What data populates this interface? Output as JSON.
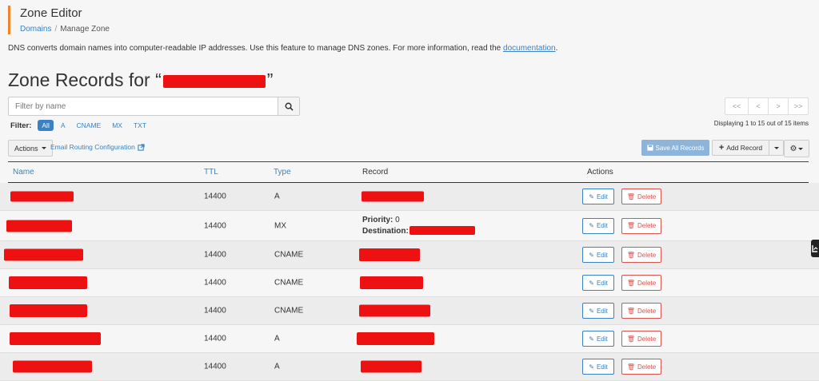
{
  "header": {
    "title": "Zone Editor",
    "breadcrumb": [
      "Domains",
      "Manage Zone"
    ],
    "accent_color": "#f08329"
  },
  "description": {
    "text": "DNS converts domain names into computer-readable IP addresses. Use this feature to manage DNS zones. For more information, read the ",
    "link": "documentation",
    "end": "."
  },
  "heading": {
    "prefix": "Zone Records for “",
    "suffix": "”",
    "domain_redacted": true
  },
  "search": {
    "placeholder": "Filter by name",
    "icon": "search-icon"
  },
  "filter": {
    "label": "Filter:",
    "options": [
      "All",
      "A",
      "CNAME",
      "MX",
      "TXT"
    ],
    "selected": "All"
  },
  "pagination": {
    "buttons": [
      "<<",
      "<",
      ">",
      ">>"
    ],
    "status": "Displaying 1 to 15 out of 15 items"
  },
  "toolbar": {
    "actions_label": "Actions",
    "email_routing_label": "Email Routing Configuration",
    "save_all_label": "Save All Records",
    "add_record_label": "Add Record",
    "settings_icon": "gear-icon",
    "primary_color": "#3a82c4"
  },
  "columns": {
    "name": "Name",
    "ttl": "TTL",
    "type": "Type",
    "record": "Record",
    "actions": "Actions"
  },
  "row_actions": {
    "edit": "Edit",
    "delete": "Delete"
  },
  "records": [
    {
      "ttl": "14400",
      "type": "A"
    },
    {
      "ttl": "14400",
      "type": "MX",
      "priority_label": "Priority:",
      "priority": "0",
      "destination_label": "Destination:"
    },
    {
      "ttl": "14400",
      "type": "CNAME"
    },
    {
      "ttl": "14400",
      "type": "CNAME"
    },
    {
      "ttl": "14400",
      "type": "CNAME"
    },
    {
      "ttl": "14400",
      "type": "A"
    },
    {
      "ttl": "14400",
      "type": "A"
    }
  ],
  "redaction_color": "#ee1111"
}
